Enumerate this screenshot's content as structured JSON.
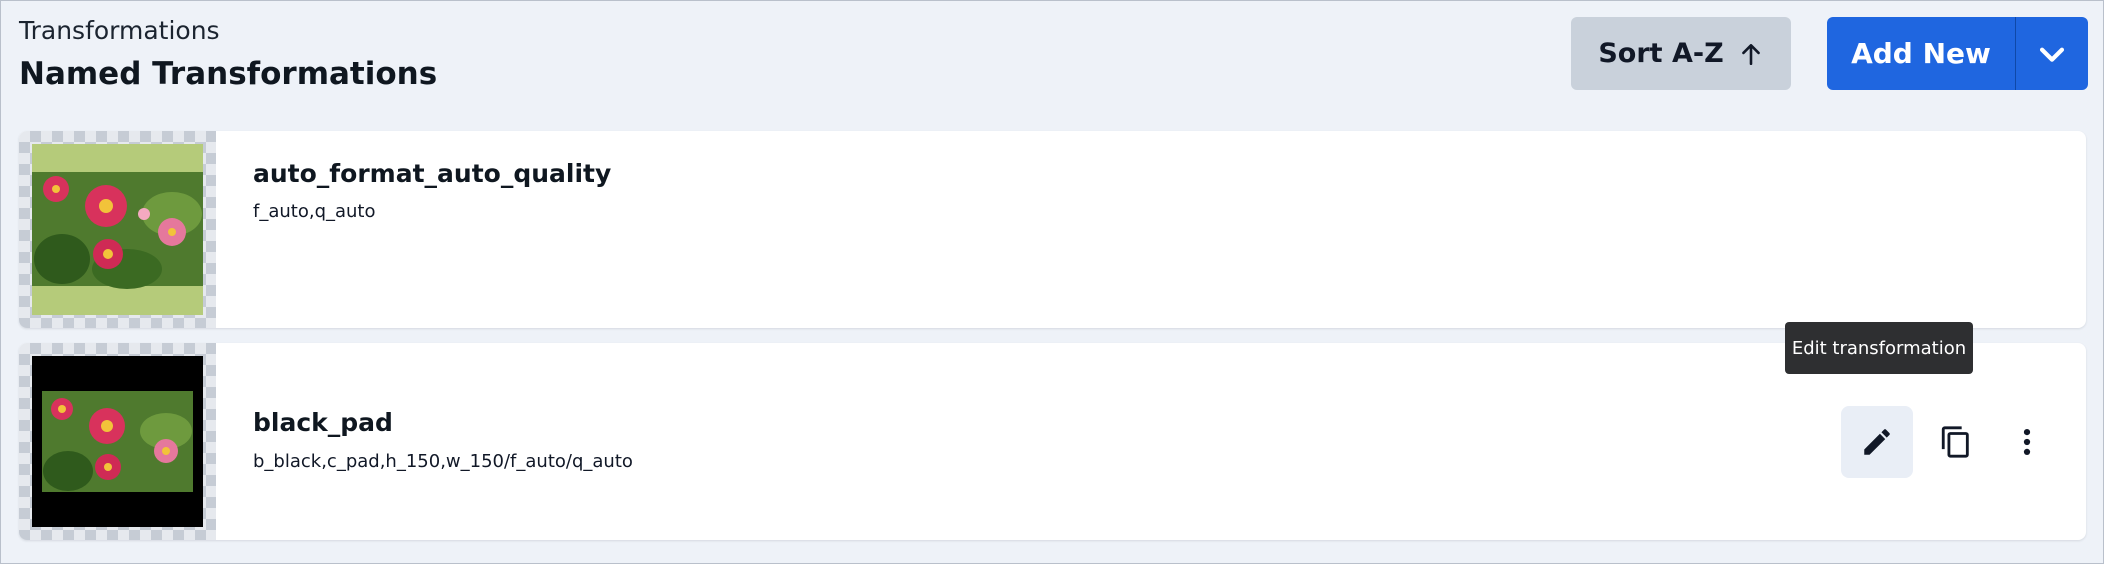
{
  "header": {
    "breadcrumb": "Transformations",
    "title": "Named Transformations",
    "sort_label": "Sort A-Z",
    "add_new_label": "Add New"
  },
  "transformations": [
    {
      "name": "auto_format_auto_quality",
      "definition": "f_auto,q_auto"
    },
    {
      "name": "black_pad",
      "definition": "b_black,c_pad,h_150,w_150/f_auto/q_auto"
    }
  ],
  "tooltip": {
    "text": "Edit transformation"
  },
  "icons": {
    "sort": "arrow-up-icon",
    "add_new_menu": "chevron-down-icon",
    "edit": "pencil-icon",
    "duplicate": "copy-icon",
    "more": "more-vert-icon"
  },
  "colors": {
    "primary": "#1f66e0",
    "secondary_button": "#c9d1db",
    "background": "#eef2f8",
    "tooltip": "#2e2f31"
  }
}
